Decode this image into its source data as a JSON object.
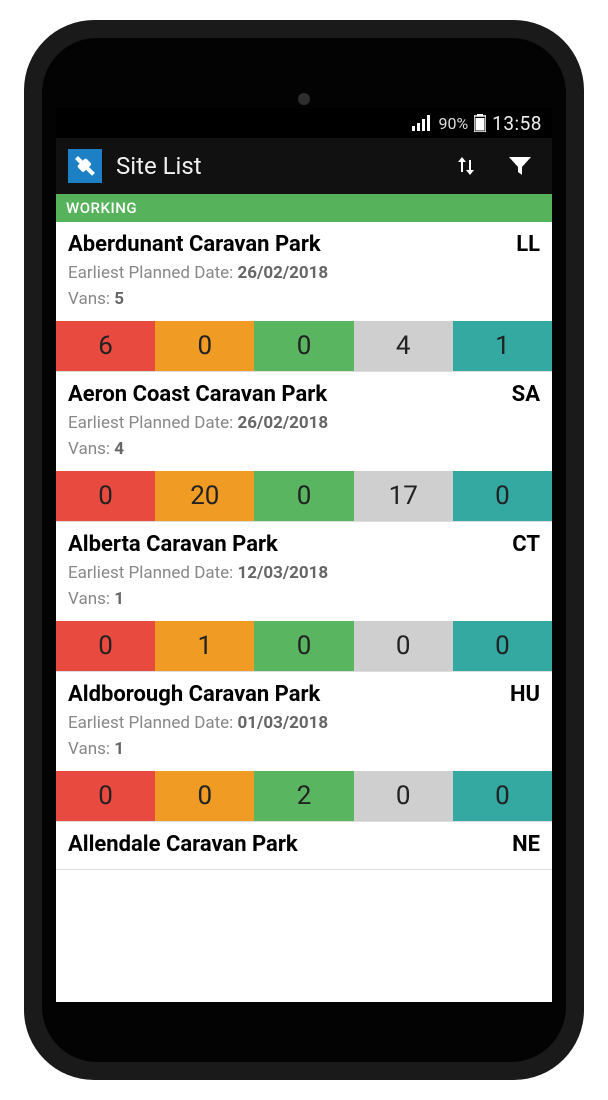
{
  "statusbar": {
    "battery_pct": "90%",
    "time": "13:58"
  },
  "appbar": {
    "title": "Site List"
  },
  "section": {
    "label": "WORKING"
  },
  "labels": {
    "earliest": "Earliest Planned Date:",
    "vans": "Vans:"
  },
  "count_colors": {
    "red": "#e94a3f",
    "orange": "#ef9b24",
    "green": "#59b560",
    "gray": "#cfcfcf",
    "teal": "#34a9a1"
  },
  "sites": [
    {
      "name": "Aberdunant Caravan Park",
      "code": "LL",
      "earliest": "26/02/2018",
      "vans": "5",
      "counts": [
        "6",
        "0",
        "0",
        "4",
        "1"
      ]
    },
    {
      "name": "Aeron Coast Caravan Park",
      "code": "SA",
      "earliest": "26/02/2018",
      "vans": "4",
      "counts": [
        "0",
        "20",
        "0",
        "17",
        "0"
      ]
    },
    {
      "name": "Alberta Caravan Park",
      "code": "CT",
      "earliest": "12/03/2018",
      "vans": "1",
      "counts": [
        "0",
        "1",
        "0",
        "0",
        "0"
      ]
    },
    {
      "name": "Aldborough Caravan Park",
      "code": "HU",
      "earliest": "01/03/2018",
      "vans": "1",
      "counts": [
        "0",
        "0",
        "2",
        "0",
        "0"
      ]
    },
    {
      "name": "Allendale Caravan Park",
      "code": "NE"
    }
  ]
}
